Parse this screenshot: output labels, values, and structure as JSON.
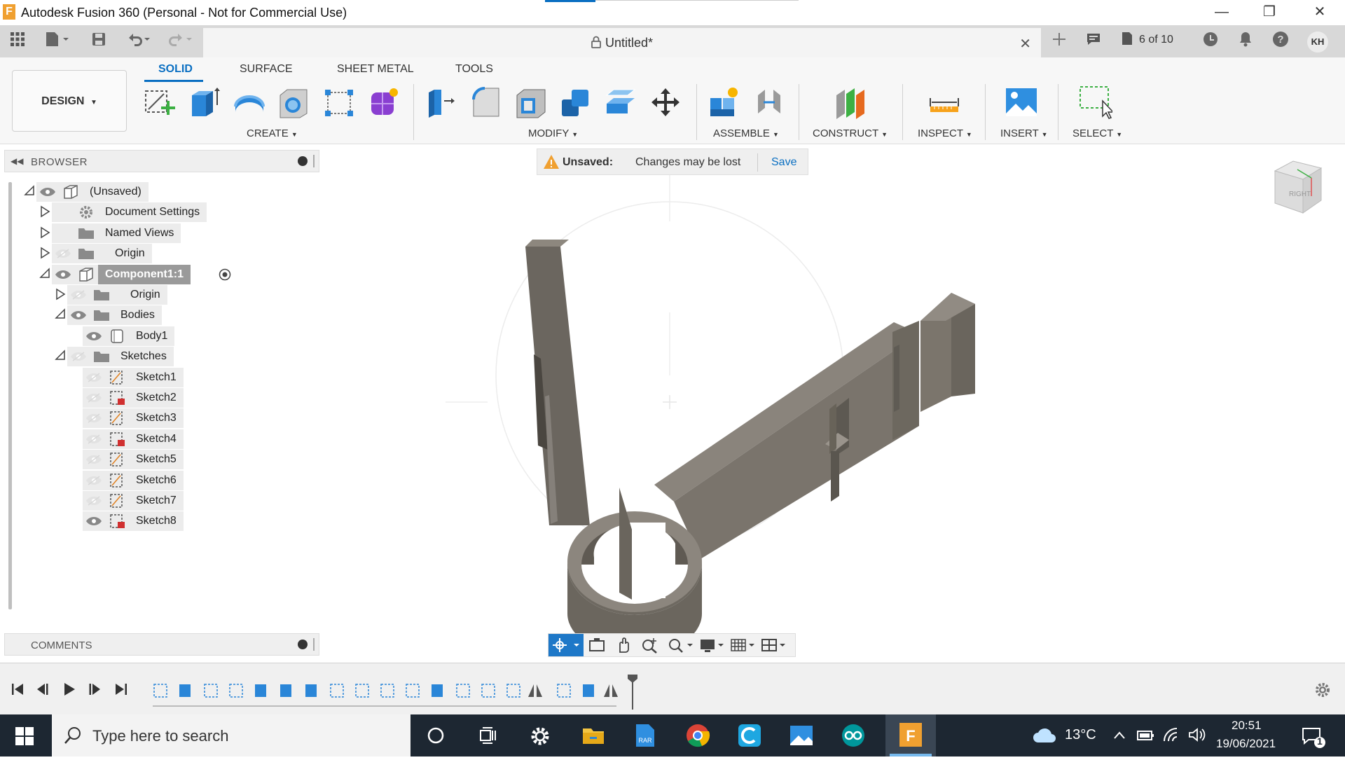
{
  "window": {
    "title": "Autodesk Fusion 360 (Personal - Not for Commercial Use)",
    "app_icon_letter": "F"
  },
  "toolbar": {
    "doc_title": "Untitled*",
    "jobs_status": "6 of 10",
    "user_initials": "KH"
  },
  "ribbon": {
    "workspace": "DESIGN",
    "tabs": [
      "SOLID",
      "SURFACE",
      "SHEET METAL",
      "TOOLS"
    ],
    "groups": [
      "CREATE",
      "MODIFY",
      "ASSEMBLE",
      "CONSTRUCT",
      "INSPECT",
      "INSERT",
      "SELECT"
    ]
  },
  "browser": {
    "title": "BROWSER",
    "rows": [
      {
        "label": "(Unsaved)"
      },
      {
        "label": "Document Settings"
      },
      {
        "label": "Named Views"
      },
      {
        "label": "Origin"
      },
      {
        "label": "Component1:1"
      },
      {
        "label": "Origin"
      },
      {
        "label": "Bodies"
      },
      {
        "label": "Body1"
      },
      {
        "label": "Sketches"
      },
      {
        "label": "Sketch1"
      },
      {
        "label": "Sketch2"
      },
      {
        "label": "Sketch3"
      },
      {
        "label": "Sketch4"
      },
      {
        "label": "Sketch5"
      },
      {
        "label": "Sketch6"
      },
      {
        "label": "Sketch7"
      },
      {
        "label": "Sketch8"
      }
    ]
  },
  "comments": {
    "title": "COMMENTS"
  },
  "unsaved_bar": {
    "warning": "Unsaved:",
    "message": "Changes may be lost",
    "save_label": "Save"
  },
  "viewcube": {
    "face_label": "RIGHT"
  },
  "taskbar": {
    "search_placeholder": "Type here to search",
    "weather": "13°C",
    "time": "20:51",
    "date": "19/06/2021",
    "notification_count": "1"
  },
  "colors": {
    "accent": "#0a6fc2",
    "model": "#7b756c",
    "taskbar": "#1d2732"
  }
}
